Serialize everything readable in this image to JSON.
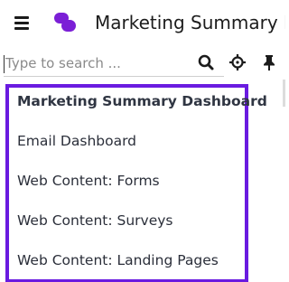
{
  "header": {
    "title": "Marketing Summary Dashboard",
    "menu_icon": "hamburger-menu-icon",
    "logo_icon": "app-logo-icon",
    "logo_color": "#7b1fd6"
  },
  "search": {
    "placeholder": "Type to search ...",
    "value": "",
    "icons": [
      "search-icon",
      "locate-crosshair-icon",
      "pin-icon"
    ]
  },
  "menu": {
    "border_color": "#6a1be0",
    "items": [
      {
        "label": "Marketing Summary Dashboard",
        "active": true
      },
      {
        "label": "Email Dashboard",
        "active": false
      },
      {
        "label": "Web Content: Forms",
        "active": false
      },
      {
        "label": "Web Content: Surveys",
        "active": false
      },
      {
        "label": "Web Content: Landing Pages",
        "active": false
      }
    ]
  }
}
